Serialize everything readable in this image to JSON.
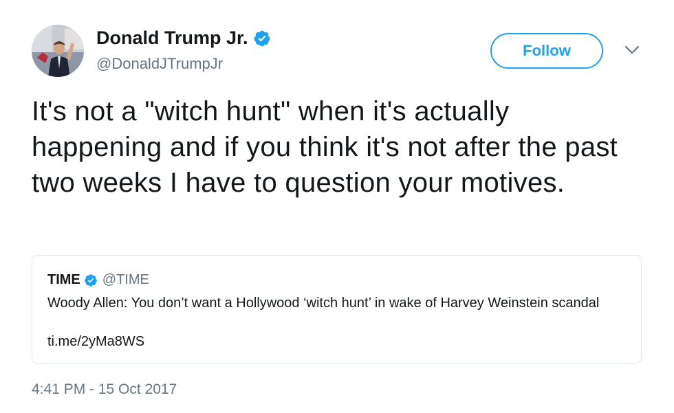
{
  "author": {
    "display_name": "Donald Trump Jr.",
    "handle": "@DonaldJTrumpJr",
    "verified_icon": "verified-badge-icon",
    "avatar_icon": "profile-photo"
  },
  "follow_button": {
    "label": "Follow"
  },
  "menu_caret": {
    "icon": "chevron-down-icon"
  },
  "tweet": {
    "text": "It's not a \"witch hunt\" when it's actually happening and if you think it's not after the past two weeks I have to question your motives.",
    "timestamp": "4:41 PM - 15 Oct 2017"
  },
  "quoted_tweet": {
    "author_name": "TIME",
    "author_handle": "@TIME",
    "text": "Woody Allen: You don’t want a Hollywood ‘witch hunt’ in wake of Harvey Weinstein scandal",
    "link": "ti.me/2yMa8WS"
  },
  "colors": {
    "accent": "#1da1f2",
    "secondary_text": "#657786",
    "primary_text": "#14171a",
    "border": "#e1e8ed"
  }
}
